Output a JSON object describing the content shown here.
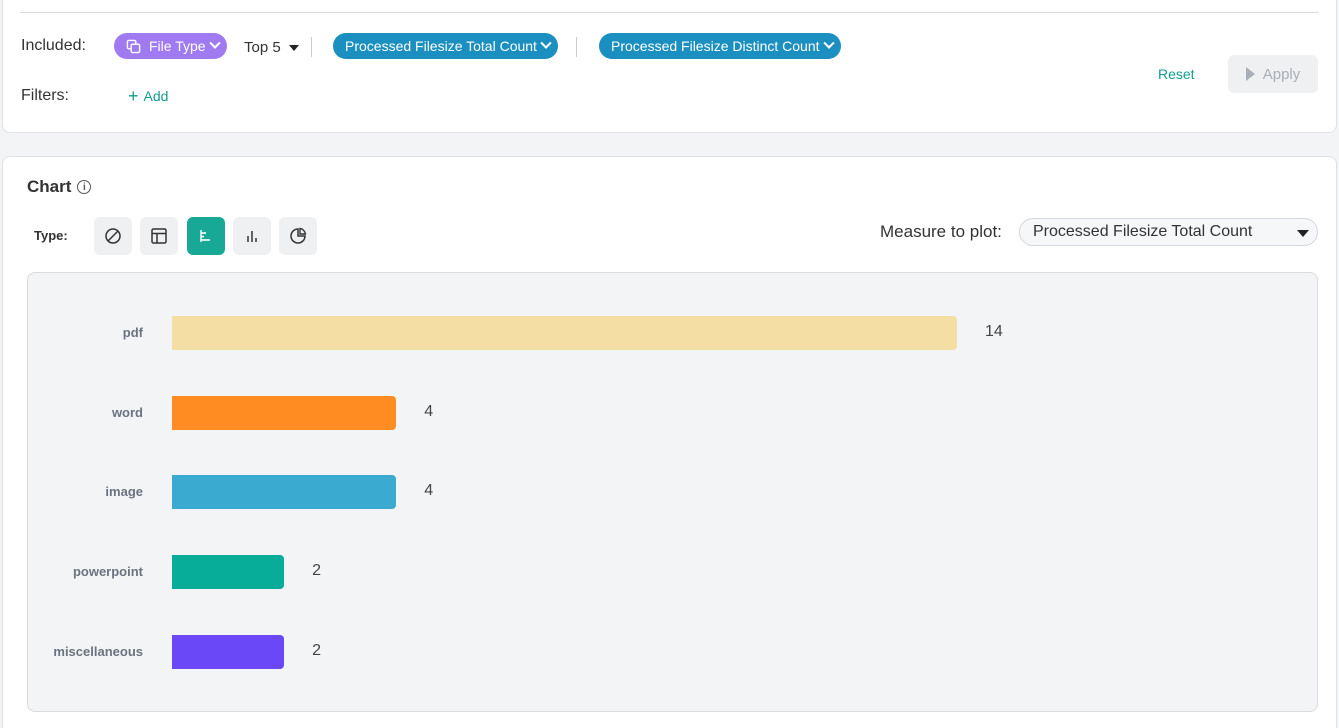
{
  "filters": {
    "included_label": "Included:",
    "filters_label": "Filters:",
    "dimension_pill": "File Type",
    "top_n": "Top 5",
    "measure_pills": [
      "Processed Filesize Total Count",
      "Processed Filesize Distinct Count"
    ],
    "add_label": "Add",
    "reset_label": "Reset",
    "apply_label": "Apply"
  },
  "chart_panel": {
    "title": "Chart",
    "info_icon": "info-icon",
    "type_label": "Type:",
    "type_buttons": [
      {
        "name": "none-chart-icon",
        "active": false
      },
      {
        "name": "table-chart-icon",
        "active": false
      },
      {
        "name": "horizontal-bar-chart-icon",
        "active": true
      },
      {
        "name": "vertical-bar-chart-icon",
        "active": false
      },
      {
        "name": "pie-chart-icon",
        "active": false
      }
    ],
    "measure_label": "Measure to plot:",
    "measure_value": "Processed Filesize Total Count"
  },
  "colors": {
    "accent": "#17a995",
    "pill_purple": "#a07af0",
    "pill_blue": "#1b8fbf"
  },
  "chart_data": {
    "type": "bar",
    "orientation": "horizontal",
    "categories": [
      "pdf",
      "word",
      "image",
      "powerpoint",
      "miscellaneous"
    ],
    "values": [
      14,
      4,
      4,
      2,
      2
    ],
    "colors": [
      "#f5dea4",
      "#ff8c22",
      "#3aaad0",
      "#07ad99",
      "#6a48f7"
    ],
    "xlim": [
      0,
      14
    ],
    "grid": false,
    "legend": "none"
  }
}
